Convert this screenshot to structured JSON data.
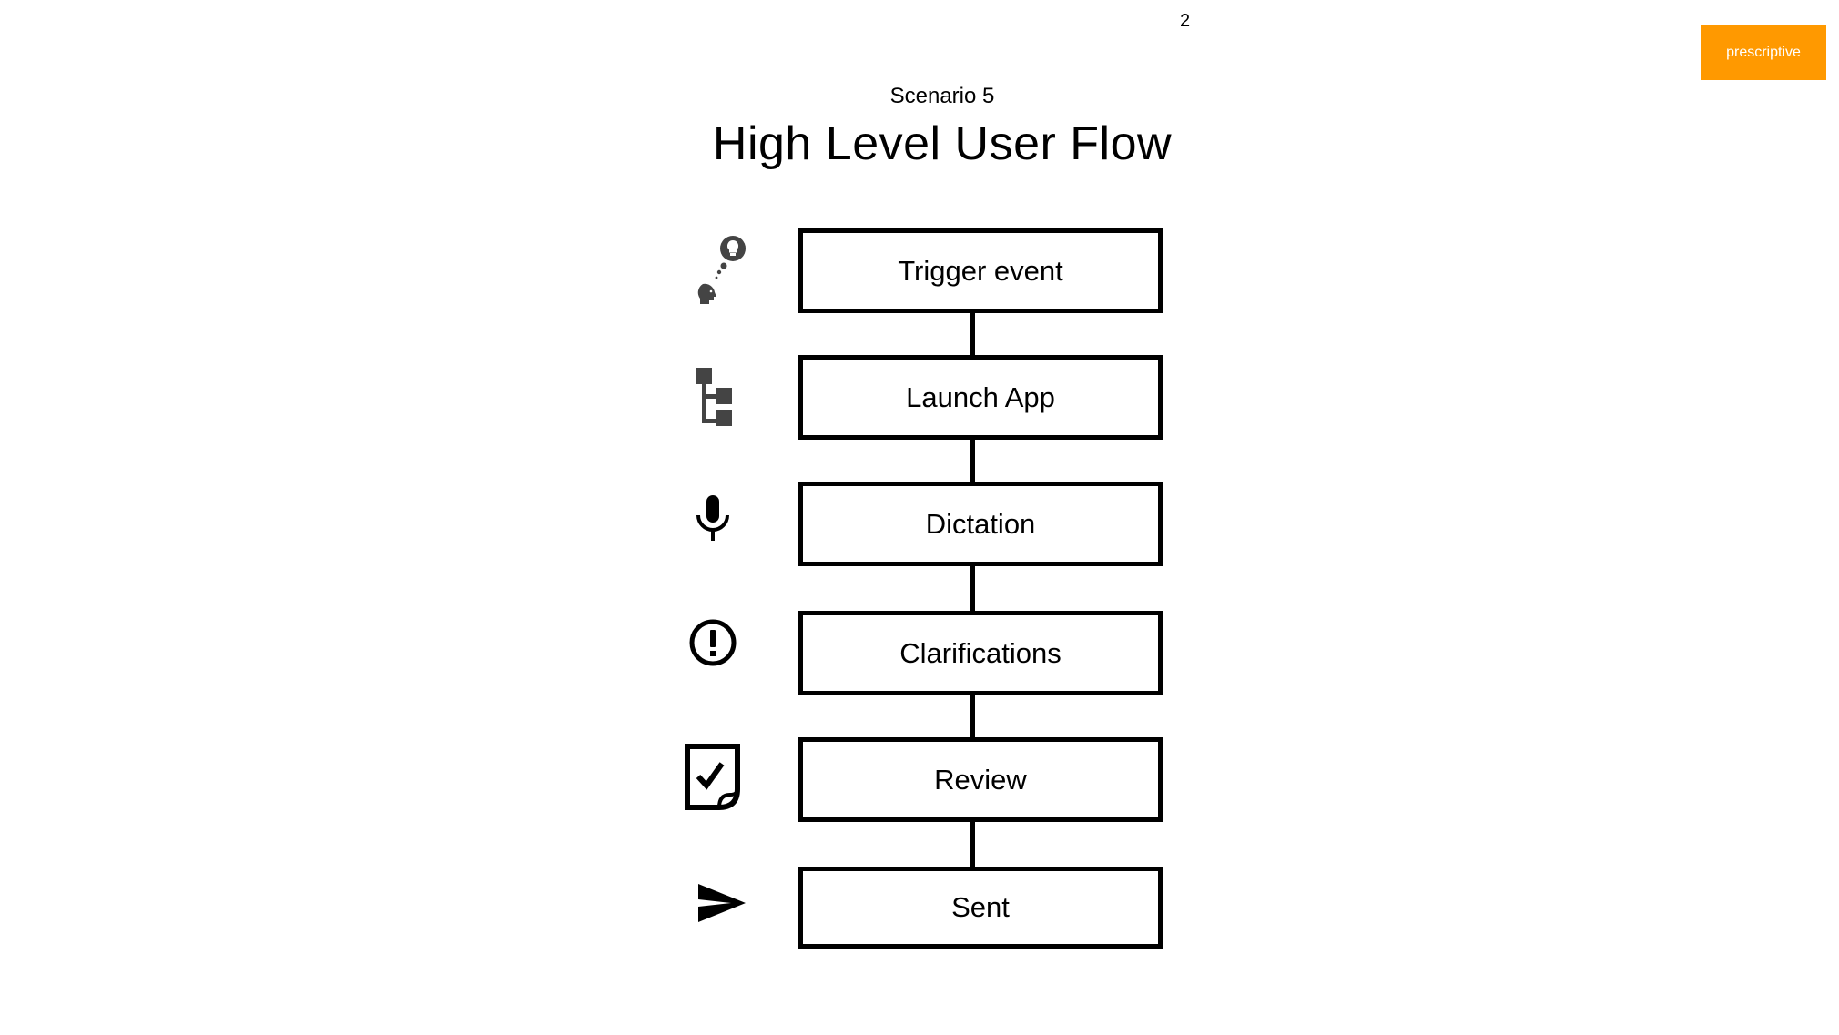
{
  "page_number": "2",
  "tag": {
    "label": "prescriptive",
    "color": "#ff9900"
  },
  "header": {
    "subtitle": "Scenario 5",
    "title": "High Level User Flow"
  },
  "flow": {
    "steps": [
      {
        "label": "Trigger event",
        "icon": "thought-idea-icon"
      },
      {
        "label": "Launch App",
        "icon": "hierarchy-tree-icon"
      },
      {
        "label": "Dictation",
        "icon": "microphone-icon"
      },
      {
        "label": "Clarifications",
        "icon": "alert-circle-icon"
      },
      {
        "label": "Review",
        "icon": "document-check-icon"
      },
      {
        "label": "Sent",
        "icon": "send-icon"
      }
    ]
  }
}
